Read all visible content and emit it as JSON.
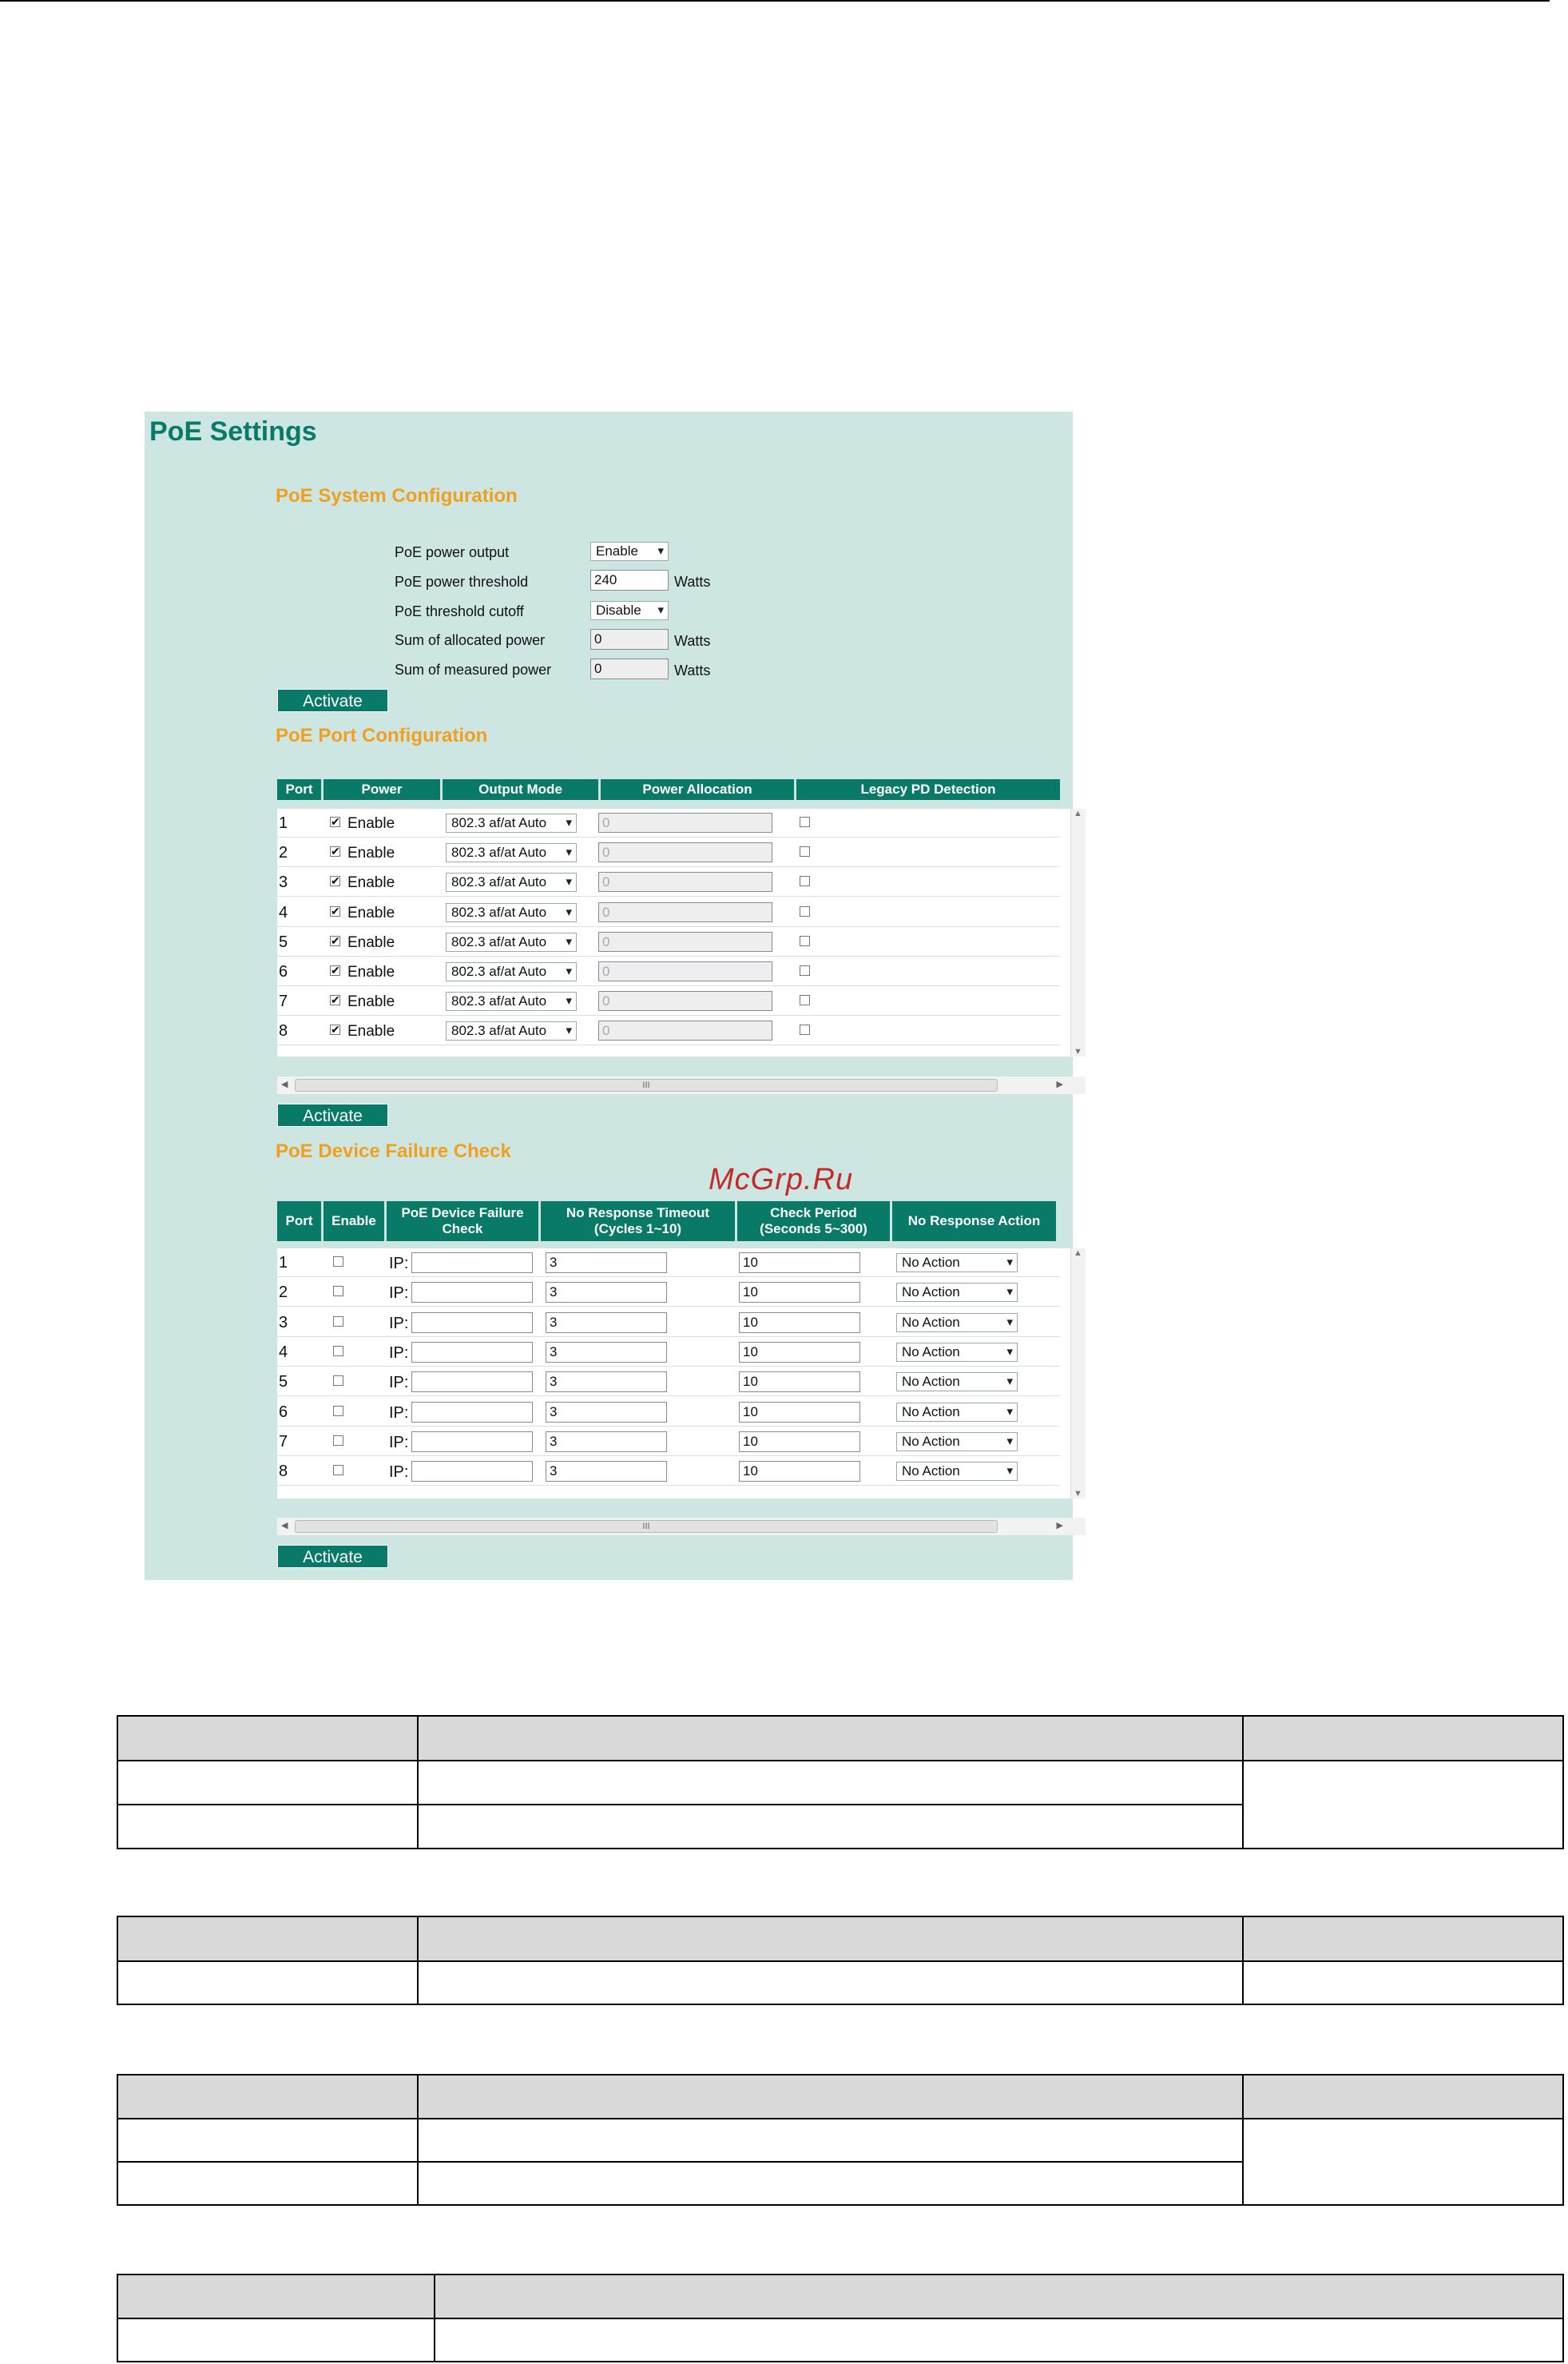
{
  "watermark": "McGrp.Ru",
  "panel": {
    "title": "PoE Settings",
    "system": {
      "heading": "PoE System Configuration",
      "power_output_label": "PoE power output",
      "power_output_value": "Enable",
      "power_threshold_label": "PoE power threshold",
      "power_threshold_value": "240",
      "threshold_cutoff_label": "PoE threshold cutoff",
      "threshold_cutoff_value": "Disable",
      "allocated_label": "Sum of allocated power",
      "allocated_value": "0",
      "measured_label": "Sum of measured power",
      "measured_value": "0",
      "unit": "Watts",
      "activate": "Activate"
    },
    "port_config": {
      "heading": "PoE Port Configuration",
      "columns": [
        "Port",
        "Power",
        "Output Mode",
        "Power Allocation",
        "Legacy PD Detection"
      ],
      "checkbox_label": "Enable",
      "check_mark": "✔",
      "rows": [
        {
          "port": "1",
          "power": true,
          "mode": "802.3 af/at Auto",
          "alloc": "0",
          "legacy": false
        },
        {
          "port": "2",
          "power": true,
          "mode": "802.3 af/at Auto",
          "alloc": "0",
          "legacy": false
        },
        {
          "port": "3",
          "power": true,
          "mode": "802.3 af/at Auto",
          "alloc": "0",
          "legacy": false
        },
        {
          "port": "4",
          "power": true,
          "mode": "802.3 af/at Auto",
          "alloc": "0",
          "legacy": false
        },
        {
          "port": "5",
          "power": true,
          "mode": "802.3 af/at Auto",
          "alloc": "0",
          "legacy": false
        },
        {
          "port": "6",
          "power": true,
          "mode": "802.3 af/at Auto",
          "alloc": "0",
          "legacy": false
        },
        {
          "port": "7",
          "power": true,
          "mode": "802.3 af/at Auto",
          "alloc": "0",
          "legacy": false
        },
        {
          "port": "8",
          "power": true,
          "mode": "802.3 af/at Auto",
          "alloc": "0",
          "legacy": false
        }
      ],
      "scroll_thumb": "III",
      "activate": "Activate"
    },
    "failure_check": {
      "heading": "PoE Device Failure Check",
      "columns": [
        "Port",
        "Enable",
        "PoE Device Failure Check",
        "No Response Timeout (Cycles 1~10)",
        "Check Period (Seconds 5~300)",
        "No Response Action"
      ],
      "ip_prefix": "IP:",
      "rows": [
        {
          "port": "1",
          "ip": "",
          "timeout": "3",
          "period": "10",
          "action": "No Action"
        },
        {
          "port": "2",
          "ip": "",
          "timeout": "3",
          "period": "10",
          "action": "No Action"
        },
        {
          "port": "3",
          "ip": "",
          "timeout": "3",
          "period": "10",
          "action": "No Action"
        },
        {
          "port": "4",
          "ip": "",
          "timeout": "3",
          "period": "10",
          "action": "No Action"
        },
        {
          "port": "5",
          "ip": "",
          "timeout": "3",
          "period": "10",
          "action": "No Action"
        },
        {
          "port": "6",
          "ip": "",
          "timeout": "3",
          "period": "10",
          "action": "No Action"
        },
        {
          "port": "7",
          "ip": "",
          "timeout": "3",
          "period": "10",
          "action": "No Action"
        },
        {
          "port": "8",
          "ip": "",
          "timeout": "3",
          "period": "10",
          "action": "No Action"
        }
      ],
      "scroll_thumb": "III",
      "activate": "Activate"
    }
  },
  "colors": {
    "panel_bg": "#cde6e2",
    "title_green": "#0a7a68",
    "section_orange": "#f0a020",
    "header_green": "#0a7a68",
    "doc_header_gray": "#d9d9d9"
  }
}
